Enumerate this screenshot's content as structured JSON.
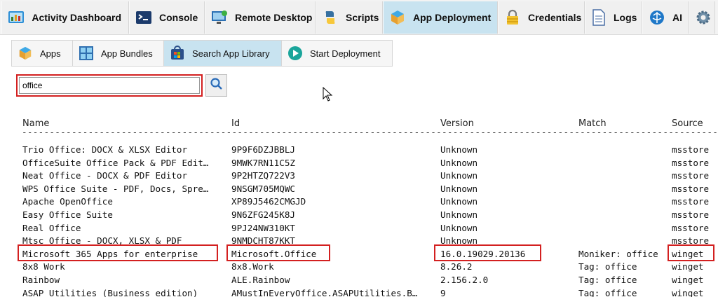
{
  "top_tabs": [
    {
      "label": "Activity Dashboard",
      "icon": "dashboard-icon",
      "active": false
    },
    {
      "label": "Console",
      "icon": "terminal-icon",
      "active": false
    },
    {
      "label": "Remote Desktop",
      "icon": "remote-desktop-icon",
      "active": false
    },
    {
      "label": "Scripts",
      "icon": "python-icon",
      "active": false
    },
    {
      "label": "App Deployment",
      "icon": "package-icon",
      "active": true
    },
    {
      "label": "Credentials",
      "icon": "lock-icon",
      "active": false
    },
    {
      "label": "Logs",
      "icon": "document-icon",
      "active": false
    },
    {
      "label": "AI",
      "icon": "brain-icon",
      "active": false
    },
    {
      "label": "",
      "icon": "gear-icon",
      "active": false
    }
  ],
  "sub_tabs": [
    {
      "label": "Apps",
      "icon": "box-icon",
      "active": false
    },
    {
      "label": "App Bundles",
      "icon": "bundle-icon",
      "active": false
    },
    {
      "label": "Search App Library",
      "icon": "store-icon",
      "active": true
    },
    {
      "label": "Start Deployment",
      "icon": "play-icon",
      "active": false
    }
  ],
  "search": {
    "value": "office",
    "placeholder": ""
  },
  "table": {
    "columns": [
      "Name",
      "Id",
      "Version",
      "Match",
      "Source"
    ],
    "separator": "----------------------------------------------------------------------------------------------------------------------------------------------------------------",
    "rows": [
      {
        "name": "Trio Office: DOCX & XLSX Editor",
        "id": "9P9F6DZJBBLJ",
        "version": "Unknown",
        "match": "",
        "source": "msstore"
      },
      {
        "name": "OfficeSuite Office Pack & PDF Edit…",
        "id": "9MWK7RN11C5Z",
        "version": "Unknown",
        "match": "",
        "source": "msstore"
      },
      {
        "name": "Neat Office - DOCX & PDF Editor",
        "id": "9P2HTZQ722V3",
        "version": "Unknown",
        "match": "",
        "source": "msstore"
      },
      {
        "name": "WPS Office Suite - PDF, Docs, Spre…",
        "id": "9NSGM705MQWC",
        "version": "Unknown",
        "match": "",
        "source": "msstore"
      },
      {
        "name": "Apache OpenOffice",
        "id": "XP89J5462CMGJD",
        "version": "Unknown",
        "match": "",
        "source": "msstore"
      },
      {
        "name": "Easy Office Suite",
        "id": "9N6ZFG245K8J",
        "version": "Unknown",
        "match": "",
        "source": "msstore"
      },
      {
        "name": "Real Office",
        "id": "9PJ24NW310KT",
        "version": "Unknown",
        "match": "",
        "source": "msstore"
      },
      {
        "name": "Mtsc Office - DOCX, XLSX & PDF",
        "id": "9NMDCHT87KKT",
        "version": "Unknown",
        "match": "",
        "source": "msstore"
      },
      {
        "name": "Microsoft 365 Apps for enterprise",
        "id": "Microsoft.Office",
        "version": "16.0.19029.20136",
        "match": "Moniker: office",
        "source": "winget"
      },
      {
        "name": "8x8 Work",
        "id": "8x8.Work",
        "version": "8.26.2",
        "match": "Tag: office",
        "source": "winget"
      },
      {
        "name": "Rainbow",
        "id": "ALE.Rainbow",
        "version": "2.156.2.0",
        "match": "Tag: office",
        "source": "winget"
      },
      {
        "name": "ASAP Utilities (Business edition)",
        "id": "AMustInEveryOffice.ASAPUtilities.B…",
        "version": "9",
        "match": "Tag: office",
        "source": "winget"
      }
    ]
  },
  "colors": {
    "active_tab": "#c8e3f0",
    "highlight": "#d32020"
  }
}
